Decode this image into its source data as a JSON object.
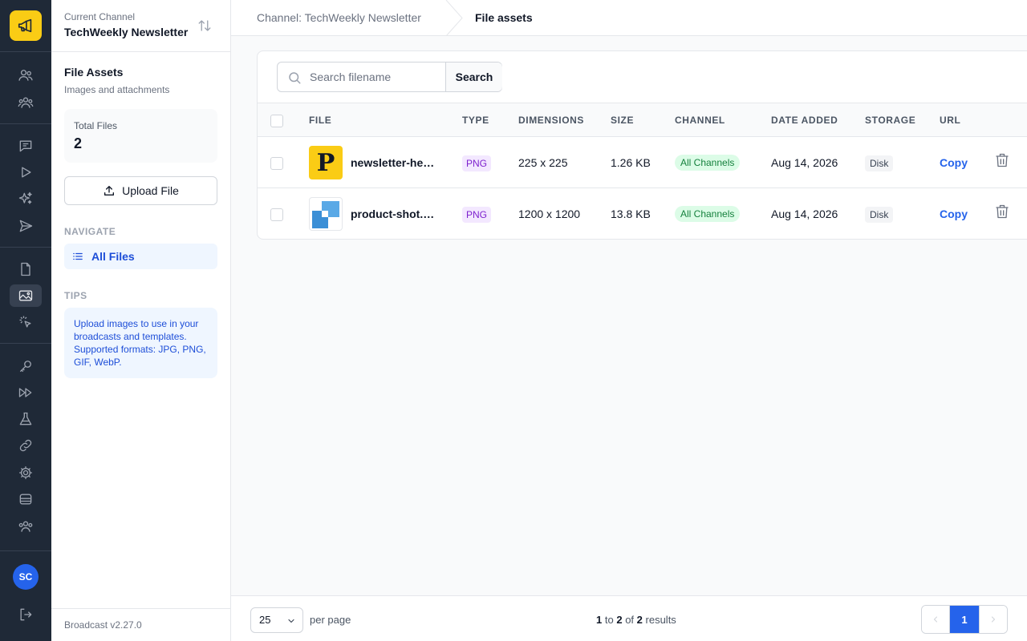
{
  "sidebar": {
    "current_channel_label": "Current Channel",
    "current_channel_name": "TechWeekly Newsletter",
    "section_title": "File Assets",
    "section_subtitle": "Images and attachments",
    "stat_label": "Total Files",
    "stat_value": "2",
    "upload_label": "Upload File",
    "navigate_heading": "NAVIGATE",
    "nav_all_files": "All Files",
    "tips_heading": "TIPS",
    "tips_text": "Upload images to use in your broadcasts and templates. Supported formats: JPG, PNG, GIF, WebP.",
    "version": "Broadcast v2.27.0"
  },
  "rail": {
    "avatar_initials": "SC"
  },
  "breadcrumb": {
    "parent": "Channel: TechWeekly Newsletter",
    "current": "File assets"
  },
  "search": {
    "placeholder": "Search filename",
    "button_label": "Search"
  },
  "table": {
    "headers": {
      "file": "FILE",
      "type": "TYPE",
      "dimensions": "DIMENSIONS",
      "size": "SIZE",
      "channel": "CHANNEL",
      "date_added": "DATE ADDED",
      "storage": "STORAGE",
      "url": "URL"
    },
    "rows": [
      {
        "filename": "newsletter-header.png",
        "type": "PNG",
        "dimensions": "225 x 225",
        "size": "1.26 KB",
        "channel": "All Channels",
        "date_added": "Aug 14, 2026",
        "storage": "Disk",
        "url_action": "Copy",
        "thumb_glyph": "P"
      },
      {
        "filename": "product-shot.png",
        "type": "PNG",
        "dimensions": "1200 x 1200",
        "size": "13.8 KB",
        "channel": "All Channels",
        "date_added": "Aug 14, 2026",
        "storage": "Disk",
        "url_action": "Copy"
      }
    ]
  },
  "pagination": {
    "per_page_value": "25",
    "per_page_label": "per page",
    "from": "1",
    "to": "2",
    "total": "2",
    "word_to": "to",
    "word_of": "of",
    "word_results": "results",
    "current_page": "1"
  },
  "colors": {
    "accent": "#2563eb",
    "rail_bg": "#1f2937",
    "logo_bg": "#facc15"
  }
}
